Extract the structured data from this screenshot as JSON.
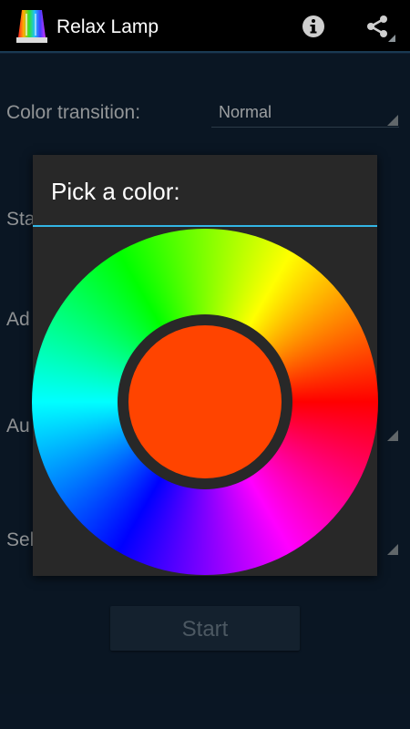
{
  "app": {
    "title": "Relax Lamp",
    "icons": {
      "app_icon": "rainbow-lamp-icon",
      "info": "info-icon",
      "share": "share-icon"
    }
  },
  "settings": {
    "color_transition": {
      "label": "Color transition:",
      "value": "Normal"
    },
    "row2_label": "Sta",
    "row3_label": "Ad",
    "row4_label": "Au",
    "row5_label": "Sel"
  },
  "start_button": {
    "label": "Start"
  },
  "dialog": {
    "title": "Pick a color:",
    "selected_color": "#ff4400",
    "accent_color": "#33b5e5"
  }
}
